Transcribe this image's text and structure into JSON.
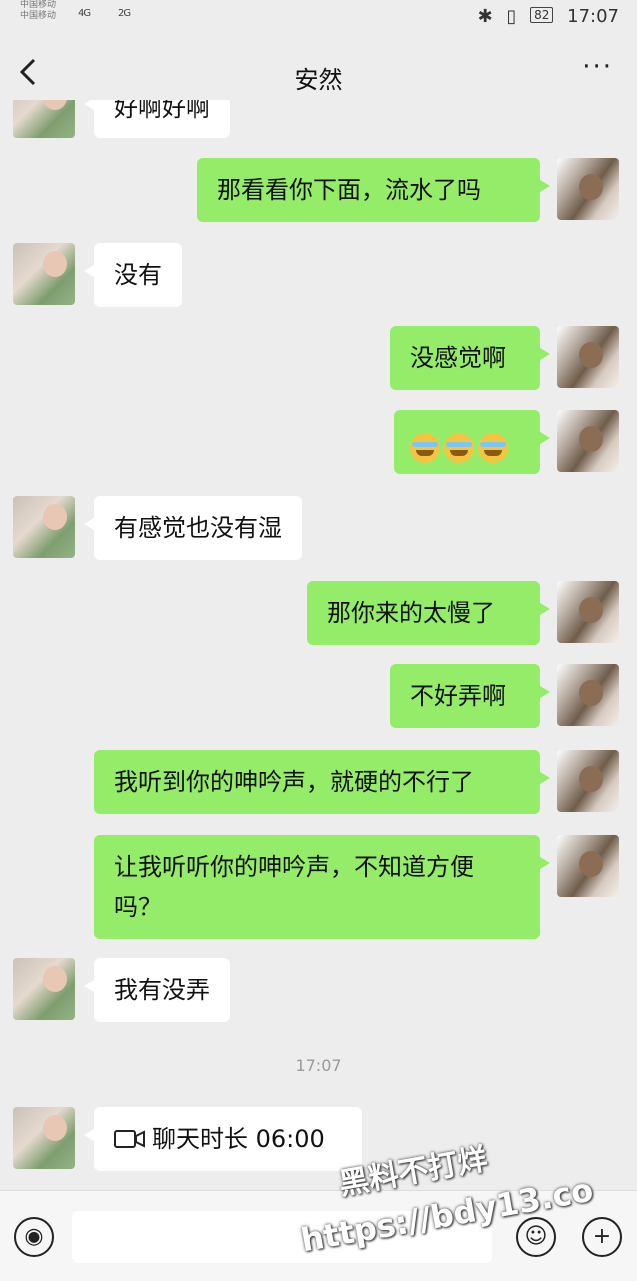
{
  "status_bar": {
    "carrier_1": "中国移动",
    "carrier_2": "中国移动",
    "signal_1": "4G",
    "signal_2": "2G",
    "time": "17:07",
    "battery": "82"
  },
  "header": {
    "title": "安然",
    "back_icon": "chevron-left-icon",
    "more_label": "···"
  },
  "messages": [
    {
      "side": "in",
      "text": "好啊好啊"
    },
    {
      "side": "out",
      "text": "那看看你下面，流水了吗"
    },
    {
      "side": "in",
      "text": "没有"
    },
    {
      "side": "out",
      "text": "没感觉啊"
    },
    {
      "side": "out",
      "text": "",
      "emojis": [
        "crying-laughing-emoji",
        "crying-laughing-emoji",
        "crying-laughing-emoji"
      ]
    },
    {
      "side": "in",
      "text": "有感觉也没有湿"
    },
    {
      "side": "out",
      "text": "那你来的太慢了"
    },
    {
      "side": "out",
      "text": "不好弄啊"
    },
    {
      "side": "out",
      "text": "我听到你的呻吟声，就硬的不行了"
    },
    {
      "side": "out",
      "text": "让我听听你的呻吟声，不知道方便吗？"
    },
    {
      "side": "in",
      "text": "我有没弄"
    }
  ],
  "timestamp": "17:07",
  "call_record": {
    "icon": "video-call-icon",
    "text": "聊天时长 06:00"
  },
  "watermark": {
    "line1": "黑料不打烊",
    "line2": "https://bdy13.co"
  },
  "input_bar": {
    "voice_icon": "voice-icon",
    "emoji_icon": "smiley-icon",
    "plus_icon": "plus-icon"
  }
}
